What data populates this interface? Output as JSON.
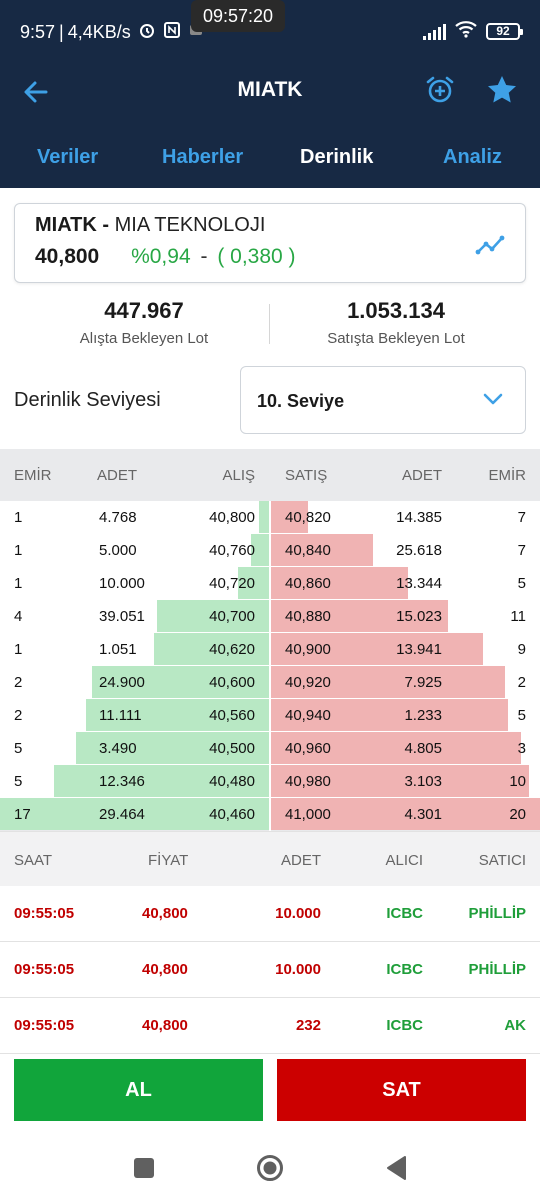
{
  "status_bar": {
    "time": "9:57",
    "network_speed": "4,4KB/s",
    "clock_overlay": "09:57:20",
    "battery": "92"
  },
  "header": {
    "title": "MIATK",
    "icons": [
      "back-arrow-icon",
      "alarm-add-icon",
      "star-icon"
    ]
  },
  "tabs": [
    {
      "label": "Veriler",
      "active": false
    },
    {
      "label": "Haberler",
      "active": false
    },
    {
      "label": "Derinlik",
      "active": true
    },
    {
      "label": "Analiz",
      "active": false
    }
  ],
  "stock": {
    "symbol": "MIATK -",
    "name": "MIA TEKNOLOJI",
    "price": "40,800",
    "change_pct": "%0,94",
    "separator": "-",
    "change_abs": "( 0,380 )"
  },
  "lots": {
    "buy_value": "447.967",
    "buy_label": "Alışta Bekleyen Lot",
    "sell_value": "1.053.134",
    "sell_label": "Satışta Bekleyen Lot"
  },
  "depth": {
    "label": "Derinlik Seviyesi",
    "selected": "10. Seviye"
  },
  "book": {
    "headers": {
      "emir_buy": "EMİR",
      "adet_buy": "ADET",
      "alis": "ALIŞ",
      "satis": "SATIŞ",
      "adet_sell": "ADET",
      "emir_sell": "EMİR"
    },
    "rows": [
      {
        "emir_buy": "1",
        "adet_buy": "4.768",
        "alis": "40,800",
        "buy_fill": 0.04,
        "satis": "40,820",
        "adet_sell": "14.385",
        "emir_sell": "7",
        "sell_fill": 0.14
      },
      {
        "emir_buy": "1",
        "adet_buy": "5.000",
        "alis": "40,760",
        "buy_fill": 0.07,
        "satis": "40,840",
        "adet_sell": "25.618",
        "emir_sell": "7",
        "sell_fill": 0.38
      },
      {
        "emir_buy": "1",
        "adet_buy": "10.000",
        "alis": "40,720",
        "buy_fill": 0.12,
        "satis": "40,860",
        "adet_sell": "13.344",
        "emir_sell": "5",
        "sell_fill": 0.51
      },
      {
        "emir_buy": "4",
        "adet_buy": "39.051",
        "alis": "40,700",
        "buy_fill": 0.42,
        "satis": "40,880",
        "adet_sell": "15.023",
        "emir_sell": "11",
        "sell_fill": 0.66
      },
      {
        "emir_buy": "1",
        "adet_buy": "1.051",
        "alis": "40,620",
        "buy_fill": 0.43,
        "satis": "40,900",
        "adet_sell": "13.941",
        "emir_sell": "9",
        "sell_fill": 0.79
      },
      {
        "emir_buy": "2",
        "adet_buy": "24.900",
        "alis": "40,600",
        "buy_fill": 0.66,
        "satis": "40,920",
        "adet_sell": "7.925",
        "emir_sell": "2",
        "sell_fill": 0.87
      },
      {
        "emir_buy": "2",
        "adet_buy": "11.111",
        "alis": "40,560",
        "buy_fill": 0.68,
        "satis": "40,940",
        "adet_sell": "1.233",
        "emir_sell": "5",
        "sell_fill": 0.88
      },
      {
        "emir_buy": "5",
        "adet_buy": "3.490",
        "alis": "40,500",
        "buy_fill": 0.72,
        "satis": "40,960",
        "adet_sell": "4.805",
        "emir_sell": "3",
        "sell_fill": 0.93
      },
      {
        "emir_buy": "5",
        "adet_buy": "12.346",
        "alis": "40,480",
        "buy_fill": 0.8,
        "satis": "40,980",
        "adet_sell": "3.103",
        "emir_sell": "10",
        "sell_fill": 0.96
      },
      {
        "emir_buy": "17",
        "adet_buy": "29.464",
        "alis": "40,460",
        "buy_fill": 1.0,
        "satis": "41,000",
        "adet_sell": "4.301",
        "emir_sell": "20",
        "sell_fill": 1.0
      }
    ]
  },
  "trades": {
    "headers": {
      "saat": "SAAT",
      "fiyat": "FİYAT",
      "adet": "ADET",
      "alici": "ALICI",
      "satici": "SATICI"
    },
    "rows": [
      {
        "saat": "09:55:05",
        "fiyat": "40,800",
        "adet": "10.000",
        "alici": "ICBC",
        "satici": "PHİLLİP"
      },
      {
        "saat": "09:55:05",
        "fiyat": "40,800",
        "adet": "10.000",
        "alici": "ICBC",
        "satici": "PHİLLİP"
      },
      {
        "saat": "09:55:05",
        "fiyat": "40,800",
        "adet": "232",
        "alici": "ICBC",
        "satici": "AK"
      }
    ]
  },
  "actions": {
    "buy": "AL",
    "sell": "SAT"
  },
  "colors": {
    "header_bg": "#172944",
    "tab_inactive": "#3ea0e6",
    "buy_bar": "#b8e8c4",
    "sell_bar": "#f0b3b3",
    "up_green": "#28a745",
    "buy_button": "#11a53b",
    "sell_button": "#cc0000"
  }
}
